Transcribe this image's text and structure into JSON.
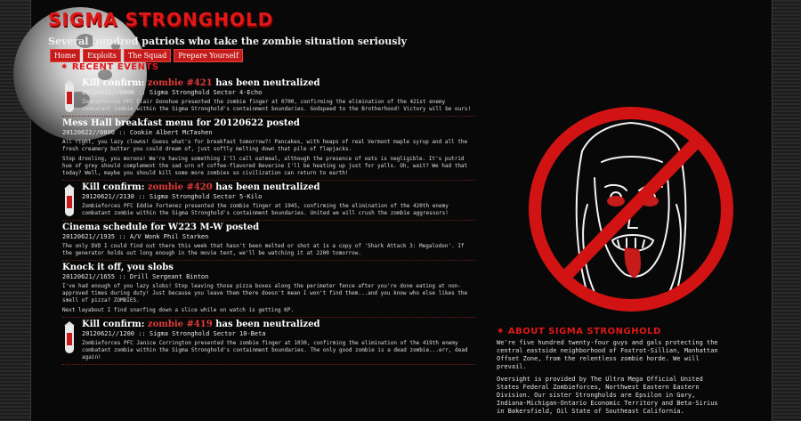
{
  "site": {
    "title": "Sigma Stronghold",
    "tagline": "Several hundred patriots who take the zombie situation seriously"
  },
  "nav": {
    "items": [
      "Home",
      "Exploits",
      "The Squad",
      "Prepare Yourself"
    ]
  },
  "recent": {
    "heading": "✷ Recent Events",
    "events": [
      {
        "type": "kill",
        "title_prefix": "Kill confirm: ",
        "zombie": "zombie #421",
        "title_suffix": " has been neutralized",
        "meta": "20120622//0800 :: Sigma Stronghold Sector 4-Echo",
        "paragraphs": [
          "Zombieforces PFC Clair Donohue presented the zombie finger at 0700, confirming the elimination of the 421st enemy combatant zombie within the Sigma Stronghold's containment boundaries. Godspeed to the Brotherhood! Victory will be ours!"
        ]
      },
      {
        "type": "post",
        "title": "Mess Hall breakfast menu for 20120622 posted",
        "meta": "20120622//0800 :: Cookie Albert McTashen",
        "paragraphs": [
          "All right, you lazy clowns! Guess what's for breakfast tomorrow?! Pancakes, with heaps of real Vermont maple syrup and all the fresh creamery butter you could dream of, just softly melting down that pile of flapjacks.",
          "Stop drooling, you morons! We're having something I'll call oatmeal, although the presence of oats is negligible. It's putrid hue of grey should complement the sad urn of coffee-flavored Beverine I'll be heating up just for yalls. Oh, wait? We had that today? Well, maybe you should kill some more zombies so civilization can return to earth!"
        ]
      },
      {
        "type": "kill",
        "title_prefix": "Kill confirm: ",
        "zombie": "zombie #420",
        "title_suffix": " has been neutralized",
        "meta": "20120621//2130 :: Sigma Stronghold Sector 5-Kilo",
        "paragraphs": [
          "Zombieforces PFC Eddie Fortenez presented the zombie finger at 1945, confirming the elimination of the 420th enemy combatant zombie within the Sigma Stronghold's containment boundaries. United we will crush the zombie aggressors!"
        ]
      },
      {
        "type": "post",
        "title": "Cinema schedule for W223 M-W posted",
        "meta": "20120621//1935 :: A/V Wonk Phil Starken",
        "paragraphs": [
          "The only DVD I could find out there this week that hasn't been melted or shot at is a copy of 'Shark Attack 3: Megalodon'. If the generator holds out long enough in the movie tent, we'll be watching it at 2200 tomorrow."
        ]
      },
      {
        "type": "post",
        "title": "Knock it off, you slobs",
        "meta": "20120621//1655 :: Drill Sergeant Binton",
        "paragraphs": [
          "I've had enough of you lazy slobs! Stop leaving those pizza boxes along the perimeter fence after you're done eating at non-approved times during duty! Just because you leave them there doesn't mean I won't find them...and you know who else likes the smell of pizza? ZOMBIES.",
          "Next layabout I find snarfing down a slice while on watch is getting KP."
        ]
      },
      {
        "type": "kill",
        "title_prefix": "Kill confirm: ",
        "zombie": "zombie #419",
        "title_suffix": " has been neutralized",
        "meta": "20120621//1200 :: Sigma Stronghold Sector 10-Beta",
        "paragraphs": [
          "Zombieforces PFC Janice Corrington presented the zombie finger at 1030, confirming the elimination of the 419th enemy combatant zombie within the Sigma Stronghold's containment boundaries. The only good zombie is a dead zombie...err, dead again!"
        ]
      }
    ]
  },
  "about": {
    "heading": "✷ About Sigma Stronghold",
    "paragraphs": [
      "We're five hundred twenty-four guys and gals protecting the central eastside neighborhood of Foxtrot-Sillian, Manhattan Offset Zone, from the relentless zombie horde. We will prevail.",
      "Oversight is provided by The Ultra Mega Official United States Federal Zombieforces, Northwest Eastern Eastern Division. Our sister Strongholds are Epsilon in Gary, Indiana-Michigan-Ontario Economic Territory and Beta-Sirius in Bakersfield, Oil State of Southeast California."
    ]
  },
  "colors": {
    "accent": "#e01818",
    "nav_bg": "#c61b1b",
    "background": "#000000"
  },
  "icons": {
    "kill": "bomb-icon",
    "hero": "no-zombie-sign-icon",
    "moon": "moon-image"
  }
}
